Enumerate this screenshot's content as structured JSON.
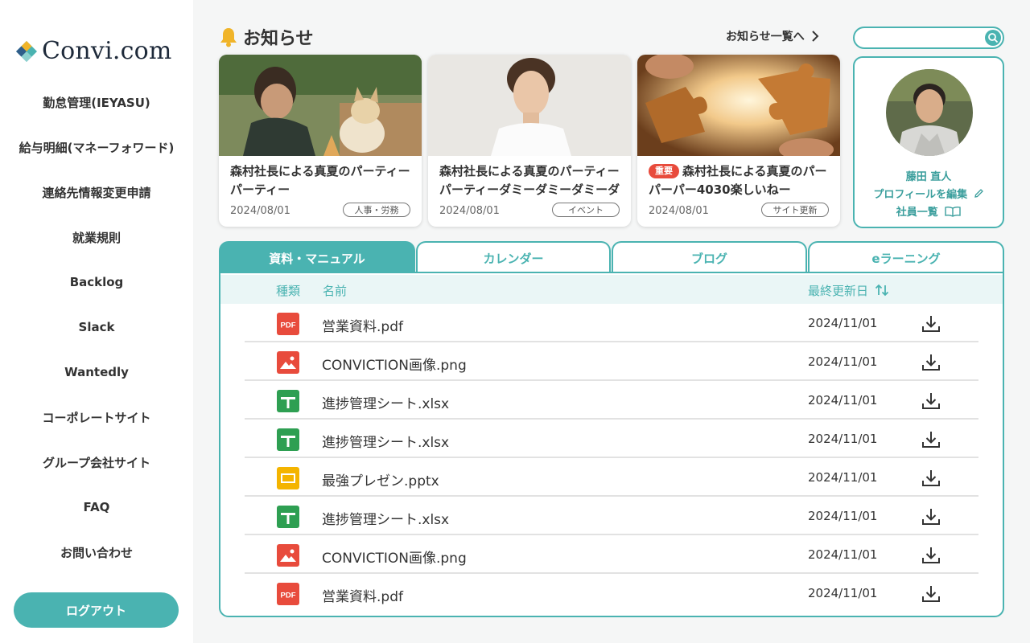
{
  "app": {
    "logo_text": "Convi.com"
  },
  "sidebar": {
    "items": [
      {
        "label": "勤怠管理(IEYASU)"
      },
      {
        "label": "給与明細(マネーフォワード)"
      },
      {
        "label": "連絡先情報変更申請"
      },
      {
        "label": "就業規則"
      },
      {
        "label": "Backlog"
      },
      {
        "label": "Slack"
      },
      {
        "label": "Wantedly"
      },
      {
        "label": "コーポレートサイト"
      },
      {
        "label": "グループ会社サイト"
      },
      {
        "label": "FAQ"
      },
      {
        "label": "お問い合わせ"
      }
    ],
    "logout_label": "ログアウト"
  },
  "news": {
    "title": "お知らせ",
    "more_label": "お知らせ一覧へ",
    "cards": [
      {
        "title": "森村社長による真夏のパーティーパーティー",
        "date": "2024/08/01",
        "tag": "人事・労務",
        "image": "man-with-dog-photo"
      },
      {
        "title": "森村社長による真夏のパーティーパーティーダミーダミーダミーダミー",
        "date": "2024/08/01",
        "tag": "イベント",
        "image": "portrait-photo"
      },
      {
        "title": "森村社長による真夏のパーパーパー4030楽しいねー",
        "date": "2024/08/01",
        "tag": "サイト更新",
        "badge": "重要",
        "image": "puzzle-photo"
      }
    ]
  },
  "search": {
    "placeholder": ""
  },
  "profile": {
    "name": "藤田 直人",
    "edit_label": "プロフィールを編集",
    "directory_label": "社員一覧"
  },
  "tabs": [
    {
      "label": "資料・マニュアル",
      "active": true
    },
    {
      "label": "カレンダー",
      "active": false
    },
    {
      "label": "ブログ",
      "active": false
    },
    {
      "label": "eラーニング",
      "active": false
    }
  ],
  "table": {
    "headers": {
      "type": "種類",
      "name": "名前",
      "updated": "最終更新日"
    },
    "rows": [
      {
        "icon": "pdf-icon",
        "name": "営業資料.pdf",
        "date": "2024/11/01"
      },
      {
        "icon": "image-icon",
        "name": "CONVICTION画像.png",
        "date": "2024/11/01"
      },
      {
        "icon": "spreadsheet-icon",
        "name": "進捗管理シート.xlsx",
        "date": "2024/11/01"
      },
      {
        "icon": "spreadsheet-icon",
        "name": "進捗管理シート.xlsx",
        "date": "2024/11/01"
      },
      {
        "icon": "slides-icon",
        "name": "最強プレゼン.pptx",
        "date": "2024/11/01"
      },
      {
        "icon": "spreadsheet-icon",
        "name": "進捗管理シート.xlsx",
        "date": "2024/11/01"
      },
      {
        "icon": "image-icon",
        "name": "CONVICTION画像.png",
        "date": "2024/11/01"
      },
      {
        "icon": "pdf-icon",
        "name": "営業資料.pdf",
        "date": "2024/11/01"
      }
    ]
  },
  "colors": {
    "accent": "#4ab3b1",
    "pdf": "#e84b3c",
    "sheet": "#2e9f52",
    "slides": "#f4b400",
    "important": "#e84b3c"
  }
}
